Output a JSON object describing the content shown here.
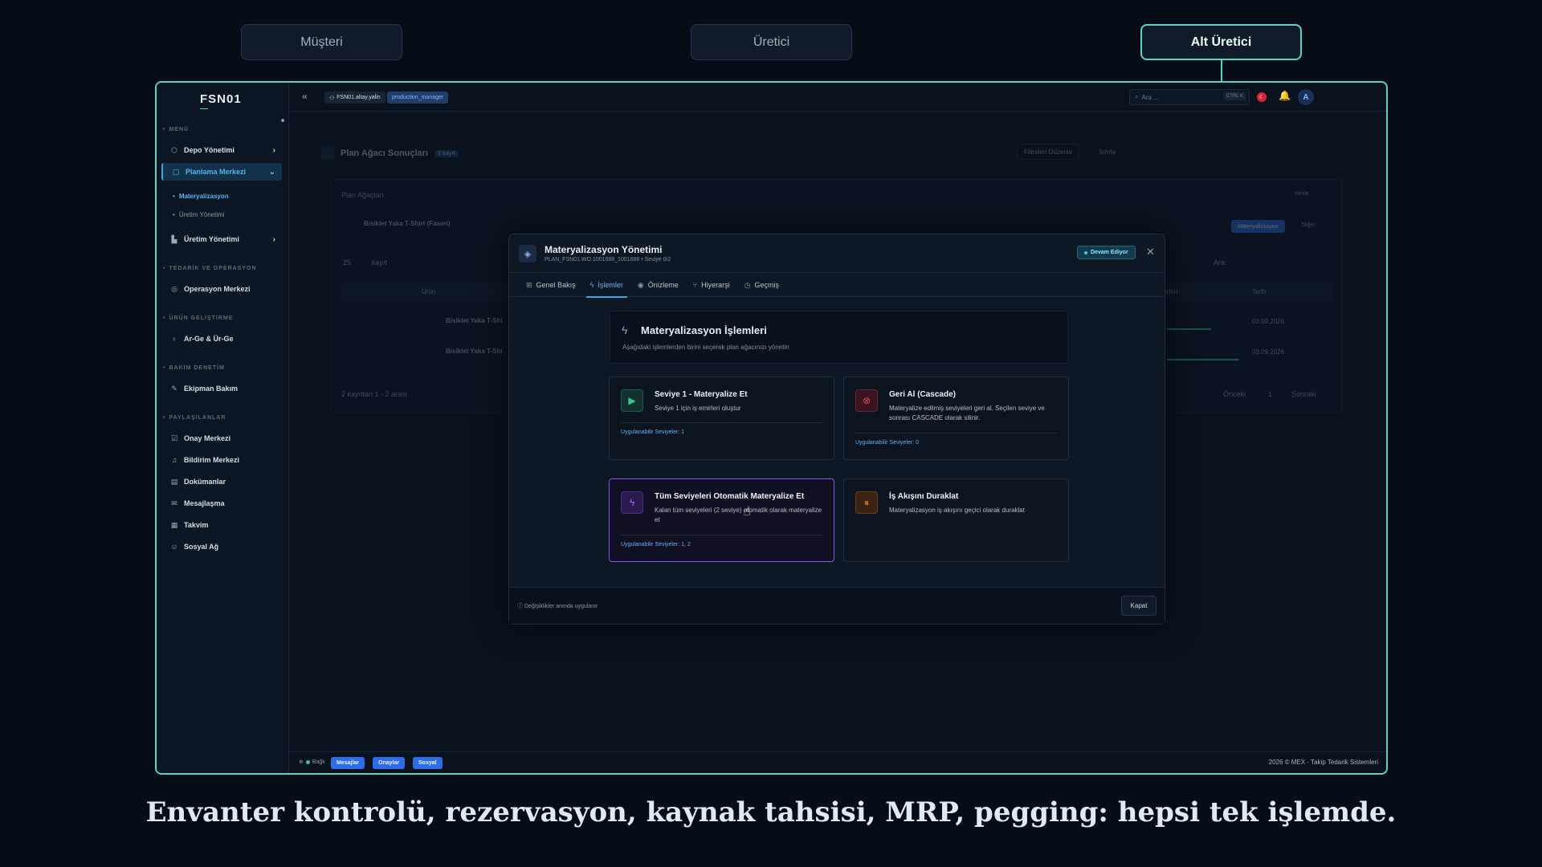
{
  "roles": [
    "Müşteri",
    "Üretici",
    "Alt Üretici"
  ],
  "app": {
    "logo": "FSN01",
    "user_chip": "FSN01.altay.yalin",
    "role_chip": "production_manager"
  },
  "topbar": {
    "search_placeholder": "Ara ...",
    "search_kbd": "CTRL K",
    "avatar": "A"
  },
  "sidebar": {
    "menu_title": "MENÜ",
    "items_main": [
      {
        "label": "Depo Yönetimi",
        "icon": "cube-icon"
      },
      {
        "label": "Planlama Merkezi",
        "icon": "box-icon"
      }
    ],
    "sub_items": [
      "Materyalizasyon",
      "Üretim Yönetimi"
    ],
    "item_uretim": "Üretim Yönetimi",
    "sec_tedarik": "TEDARİK VE OPERASYON",
    "item_operasyon": "Operasyon Merkezi",
    "sec_urun": "ÜRÜN GELİŞTİRME",
    "item_arge": "Ar-Ge & Ür-Ge",
    "sec_bakim": "BAKIM DENETİM",
    "item_ekipman": "Ekipman Bakım",
    "sec_paylasilan": "PAYLAŞILANLAR",
    "shared": [
      "Onay Merkezi",
      "Bildirim Merkezi",
      "Dokümanlar",
      "Mesajlaşma",
      "Takvim",
      "Sosyal Ağ"
    ]
  },
  "background_page": {
    "title": "Plan Ağacı Sonuçları",
    "count": "2 kayıt",
    "filters_button": "Filtreleri Düzenle",
    "reset_button": "Sıfırla",
    "card_title": "Plan Ağaçları",
    "refresh": "Yenile",
    "row_main": "Bisiklet Yaka T-Shirt (Fason)",
    "materialize_btn": "Materyalizasyon",
    "other_btn": "Diğer",
    "page_size": "25",
    "page_size_label": "kayıt",
    "search_label": "Ara:",
    "col_urun": "Ürün",
    "col_fiyat": "irleri",
    "col_tarih": "Tarih",
    "rows": [
      {
        "name": "Bisiklet Yaka T-Shi",
        "date": "03.09.2026"
      },
      {
        "name": "Bisiklet Yaka T-Shi",
        "date": "03.09.2026"
      }
    ],
    "summary": "2 kayıttan 1 - 2 arası",
    "prev": "Önceki",
    "page": "1",
    "next": "Sonraki"
  },
  "modal": {
    "title": "Materyalizasyon Yönetimi",
    "subtitle": "PLAN_FSN01.WO.1001688_1001688 • Seviye 0/2",
    "status": "Devam Ediyor",
    "tabs": [
      {
        "label": "Genel Bakış",
        "icon": "grid-icon"
      },
      {
        "label": "İşlemler",
        "icon": "bolt-icon"
      },
      {
        "label": "Önizleme",
        "icon": "eye-icon"
      },
      {
        "label": "Hiyerarşi",
        "icon": "branch-icon"
      },
      {
        "label": "Geçmiş",
        "icon": "clock-icon"
      }
    ],
    "ops_title": "Materyalizasyon İşlemleri",
    "ops_desc": "Aşağıdaki işlemlerden birini seçerek plan ağacınızı yönetin",
    "ops": [
      {
        "title": "Seviye 1 - Materyalize Et",
        "desc": "Seviye 1 için iş emirleri oluştur",
        "meta": "Uygulanabilir Seviyeler: 1",
        "icon": "play-icon",
        "color": "#36c7a0"
      },
      {
        "title": "Geri Al (Cascade)",
        "desc": "Materyalize edilmiş seviyeleri geri al. Seçilen seviye ve sonrası CASCADE olarak silinir.",
        "meta": "Uygulanabilir Seviyeler: 0",
        "icon": "cancel-icon",
        "color": "#e0485b"
      },
      {
        "title": "Tüm Seviyeleri Otomatik Materyalize Et",
        "desc": "Kalan tüm seviyeleri (2 seviye) otomatik olarak materyalize et",
        "meta": "Uygulanabilir Seviyeler: 1, 2",
        "icon": "bolt-icon",
        "color": "#9a6cf7"
      },
      {
        "title": "İş Akışını Duraklat",
        "desc": "Materyalizasyon iş akışını geçici olarak duraklat",
        "meta": "",
        "icon": "pause-icon",
        "color": "#e0803a"
      }
    ],
    "footer_note": "Değişiklikler anında uygulanır",
    "close": "Kapat"
  },
  "bottombar": {
    "connection": "Bağlı",
    "buttons": [
      "Mesajlar",
      "Onaylar",
      "Sosyal"
    ],
    "copyright": "2026 © MEX · Takip Tedarik Sistemleri"
  },
  "caption": "Envanter kontrolü, rezervasyon, kaynak tahsisi, MRP, pegging: hepsi tek işlemde.",
  "colors": {
    "accent_teal": "#56d4c4",
    "primary_blue": "#3aa6e6",
    "selected_purple": "#8a57f5"
  }
}
